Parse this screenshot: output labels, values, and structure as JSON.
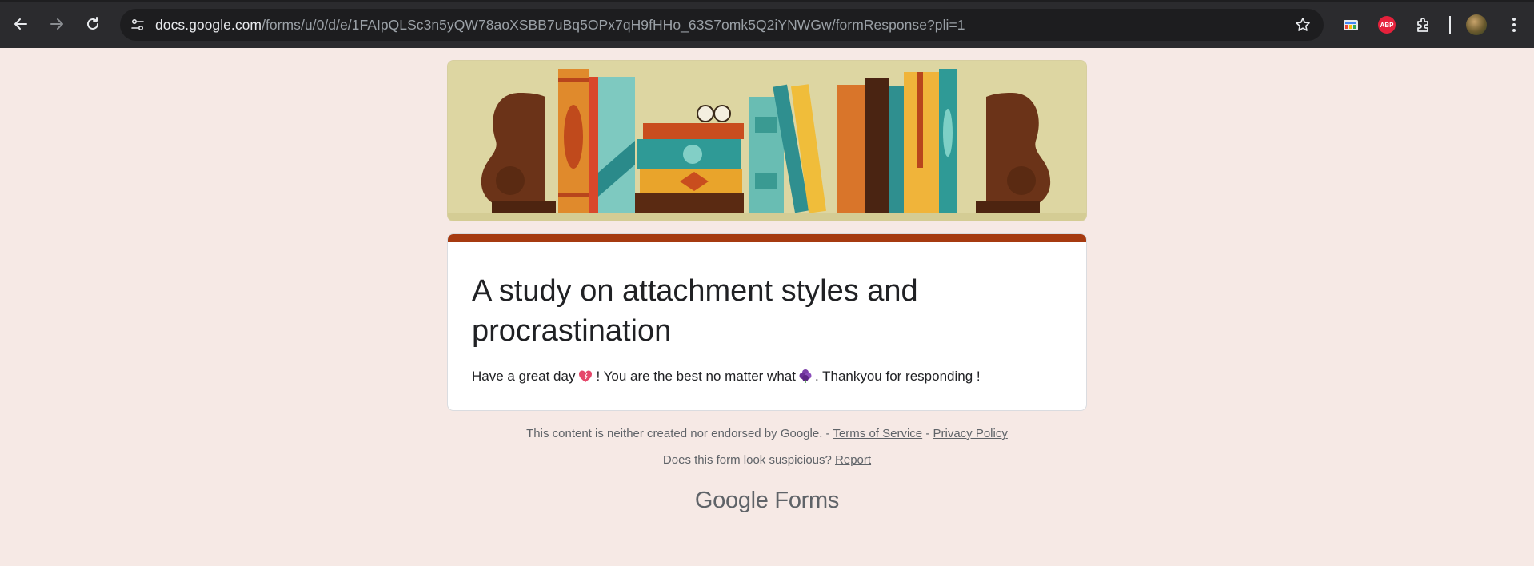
{
  "browser": {
    "url_host": "docs.google.com",
    "url_path": "/forms/u/0/d/e/1FAIpQLSc3n5yQW78aoXSBB7uBq5OPx7qH9fHHo_63S7omk5Q2iYNWGw/formResponse?pli=1",
    "abp_label": "ABP",
    "icons": {
      "back": "arrow-left-icon",
      "forward": "arrow-right-icon",
      "reload": "reload-icon",
      "site_settings": "tune-icon",
      "bookmark": "star-icon",
      "extensions": "puzzle-icon",
      "menu": "kebab-menu-icon"
    }
  },
  "form": {
    "accent_color": "#a63a10",
    "title": "A study on attachment styles and procrastination",
    "description_part1": "Have a great day",
    "description_part2": "! You are the best no matter what",
    "description_part3": ". Thankyou for responding !"
  },
  "footer": {
    "disclaimer": "This content is neither created nor endorsed by Google. -",
    "terms_label": "Terms of Service",
    "separator": "-",
    "privacy_label": "Privacy Policy",
    "suspicious_text": "Does this form look suspicious?",
    "report_label": "Report",
    "brand_google": "Google",
    "brand_forms": "Forms"
  },
  "colors": {
    "page_background": "#f6e9e5",
    "toolbar": "#2b2b2e",
    "omnibox": "#1d1d1f"
  }
}
